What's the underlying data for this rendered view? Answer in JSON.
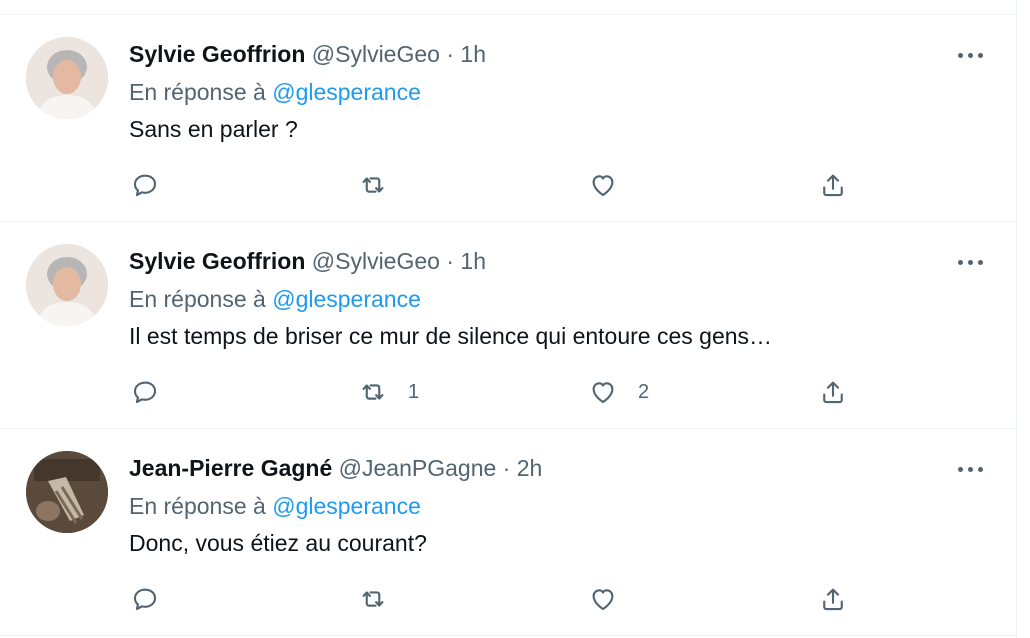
{
  "tweets": [
    {
      "author_name": "Sylvie Geoffrion",
      "handle": "@SylvieGeo",
      "separator": "·",
      "time": "1h",
      "reply_prefix": "En réponse à",
      "reply_to": "@glesperance",
      "text": "Sans en parler ?",
      "retweet_count": "",
      "like_count": ""
    },
    {
      "author_name": "Sylvie Geoffrion",
      "handle": "@SylvieGeo",
      "separator": "·",
      "time": "1h",
      "reply_prefix": "En réponse à",
      "reply_to": "@glesperance",
      "text": "Il est temps de briser ce mur de silence qui entoure ces gens…",
      "retweet_count": "1",
      "like_count": "2"
    },
    {
      "author_name": "Jean-Pierre Gagné",
      "handle": "@JeanPGagne",
      "separator": "·",
      "time": "2h",
      "reply_prefix": "En réponse à",
      "reply_to": "@glesperance",
      "text": "Donc, vous étiez au courant?",
      "retweet_count": "",
      "like_count": ""
    }
  ],
  "icons": {
    "more": "more-horizontal-icon",
    "reply": "reply-bubble-icon",
    "retweet": "retweet-icon",
    "like": "heart-icon",
    "share": "share-upload-icon"
  },
  "colors": {
    "text": "#0f1419",
    "secondary": "#536471",
    "link": "#1d9bf0",
    "divider": "#eff3f4"
  }
}
